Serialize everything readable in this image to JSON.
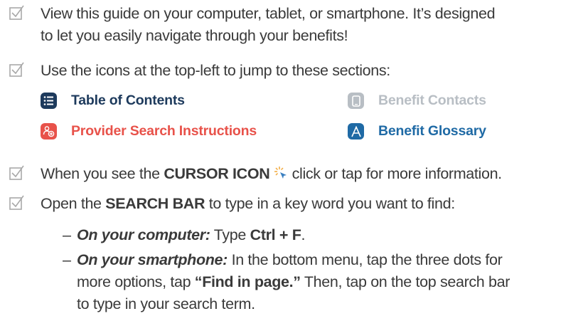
{
  "items": [
    {
      "line1": "View this guide on your computer, tablet, or smartphone. It’s designed",
      "line2": "to let you easily navigate through your benefits!"
    },
    {
      "text": "Use the icons at the top-left to jump to these sections:"
    },
    {
      "pre": "When you see the ",
      "bold": "CURSOR ICON",
      "post": " click or tap for more information."
    },
    {
      "pre": "Open the ",
      "bold": "SEARCH BAR",
      "post": " to type in a key word you want to find:"
    }
  ],
  "sections": [
    {
      "label": "Table of Contents",
      "icon": "list-icon",
      "color": "#1d3a5c"
    },
    {
      "label": "Benefit Contacts",
      "icon": "phone-icon",
      "color": "#b8bec4"
    },
    {
      "label": "Provider Search Instructions",
      "icon": "provider-search-icon",
      "color": "#e8524a"
    },
    {
      "label": "Benefit Glossary",
      "icon": "glossary-icon",
      "color": "#1f6aa5"
    }
  ],
  "search_tips": [
    {
      "label": "On your computer:",
      "pre": " Type ",
      "bold": "Ctrl + F",
      "post": "."
    },
    {
      "label": "On your smartphone:",
      "pre": " In the bottom menu, tap the three dots for",
      "line2_pre": "more options, tap ",
      "bold": "“Find in page.”",
      "post": " Then, tap on the top search bar",
      "line3": "to type in your search term."
    }
  ],
  "dash": "–"
}
